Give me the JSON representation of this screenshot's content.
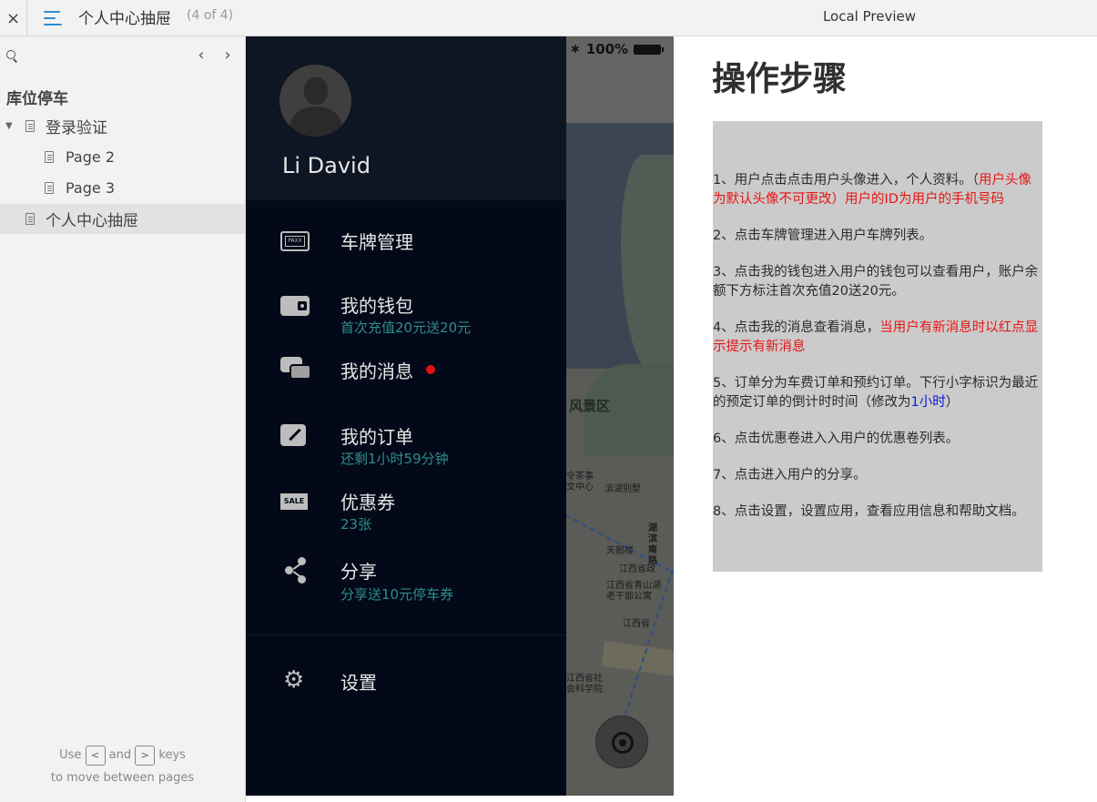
{
  "topbar": {
    "close_label": "×",
    "page_title": "个人中心抽屉",
    "page_count": "(4 of 4)",
    "preview_label": "Local Preview"
  },
  "sidebar": {
    "prev_arrow": "‹",
    "next_arrow": "›",
    "project_name": "库位停车",
    "tree": [
      {
        "label": "登录验证"
      },
      {
        "label": "Page 2"
      },
      {
        "label": "Page 3"
      },
      {
        "label": "个人中心抽屉"
      }
    ],
    "hint": {
      "use": "Use",
      "and": "and",
      "keys": "keys",
      "line2": "to move between pages",
      "key_prev": "<",
      "key_next": ">"
    }
  },
  "phone": {
    "status": {
      "bluetooth": "∗",
      "battery_text": "100%"
    },
    "user_name": "Li David",
    "menu": [
      {
        "label": "车牌管理",
        "sub": "",
        "icon": "plate-icon",
        "icon_text": "PAXX"
      },
      {
        "label": "我的钱包",
        "sub": "首次充值20元送20元",
        "icon": "wallet-icon"
      },
      {
        "label": "我的消息",
        "sub": "",
        "icon": "chat-icon"
      },
      {
        "label": "我的订单",
        "sub": "还剩1小时59分钟",
        "icon": "edit-icon"
      },
      {
        "label": "优惠券",
        "sub": "23张",
        "icon": "sale-tag-icon",
        "icon_text": "SALE"
      },
      {
        "label": "分享",
        "sub": "分享送10元停车券",
        "icon": "share-icon"
      }
    ],
    "settings": {
      "label": "设置",
      "icon": "gear-icon"
    },
    "map": {
      "scenic_label": "风景区",
      "labels": [
        "令茶事\n文中心",
        "滨湖别墅",
        "湖滨南路",
        "天鹅楼",
        "江西省政",
        "江西省青山湖\n老干部公寓",
        "江西省",
        "江西省社\n会科学院"
      ]
    }
  },
  "notes": {
    "title": "操作步骤",
    "items": [
      {
        "parts": [
          {
            "text": "1、用户点击点击用户头像进入，个人资料。（",
            "color": "normal"
          },
          {
            "text": "用户头像为默认头像不可更改）用户的ID为用户的手机号码",
            "color": "red"
          }
        ]
      },
      {
        "parts": [
          {
            "text": "2、点击车牌管理进入用户车牌列表。",
            "color": "normal"
          }
        ]
      },
      {
        "parts": [
          {
            "text": "3、点击我的钱包进入用户的钱包可以查看用户，账户余额下方标注首次充值20送20元。",
            "color": "normal"
          }
        ]
      },
      {
        "parts": [
          {
            "text": "4、点击我的消息查看消息，",
            "color": "normal"
          },
          {
            "text": "当用户有新消息时以红点显示提示有新消息",
            "color": "red"
          }
        ]
      },
      {
        "parts": [
          {
            "text": "5、订单分为车费订单和预约订单。下行小字标识为最近的预定订单的倒计时时间（修改为",
            "color": "normal"
          },
          {
            "text": "1小时",
            "color": "blue"
          },
          {
            "text": "）",
            "color": "normal"
          }
        ]
      },
      {
        "parts": [
          {
            "text": "6、点击优惠卷进入入用户的优惠卷列表。",
            "color": "normal"
          }
        ]
      },
      {
        "parts": [
          {
            "text": "7、点击进入用户的分享。",
            "color": "normal"
          }
        ]
      },
      {
        "parts": [
          {
            "text": "8、点击设置，设置应用，查看应用信息和帮助文档。",
            "color": "normal"
          }
        ]
      }
    ]
  }
}
